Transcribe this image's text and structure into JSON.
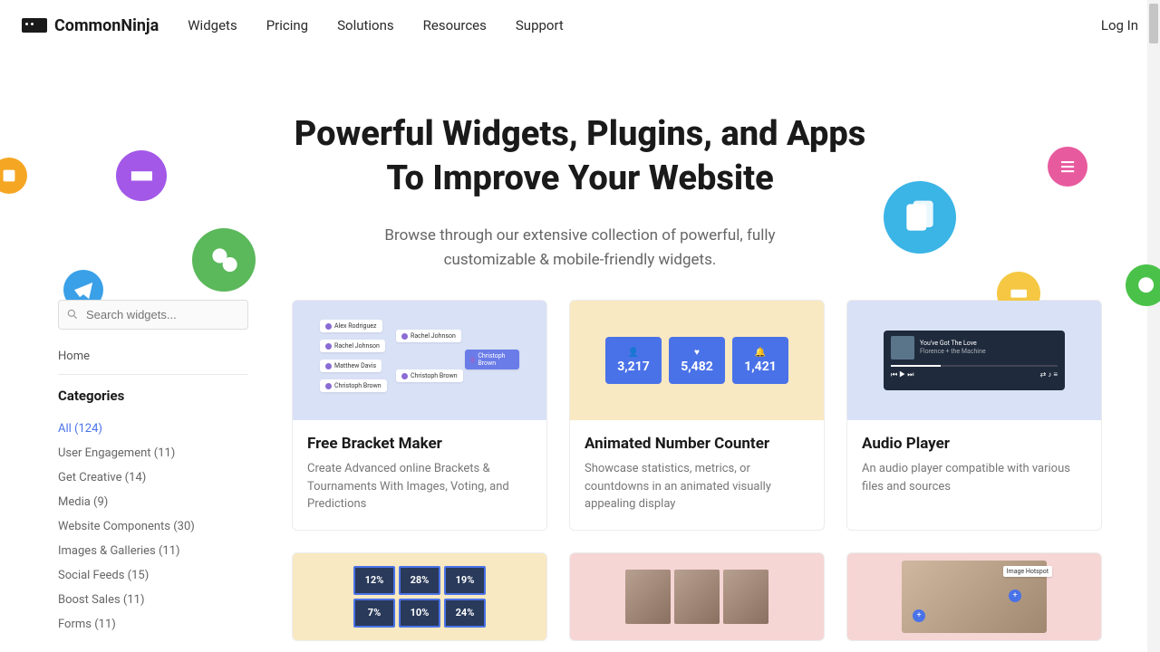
{
  "header": {
    "brand": "CommonNinja",
    "nav": [
      "Widgets",
      "Pricing",
      "Solutions",
      "Resources",
      "Support"
    ],
    "login": "Log In"
  },
  "hero": {
    "title_line1": "Powerful Widgets, Plugins, and Apps",
    "title_line2": "To Improve Your Website",
    "subtitle": "Browse through our extensive collection of powerful, fully customizable & mobile-friendly widgets."
  },
  "sidebar": {
    "search_placeholder": "Search widgets...",
    "home": "Home",
    "categories_title": "Categories",
    "categories": [
      {
        "label": "All (124)",
        "active": true
      },
      {
        "label": "User Engagement (11)"
      },
      {
        "label": "Get Creative (14)"
      },
      {
        "label": "Media (9)"
      },
      {
        "label": "Website Components (30)"
      },
      {
        "label": "Images & Galleries (11)"
      },
      {
        "label": "Social Feeds (15)"
      },
      {
        "label": "Boost Sales (11)"
      },
      {
        "label": "Forms (11)"
      }
    ]
  },
  "cards": [
    {
      "title": "Free Bracket Maker",
      "desc": "Create Advanced online Brackets & Tournaments With Images, Voting, and Predictions",
      "bg": "img-blue",
      "bracket_names": [
        "Alex Rodriguez",
        "Rachel Johnson",
        "Matthew Davis",
        "Christoph Brown",
        "Rachel Johnson",
        "Christoph Brown",
        "Christoph Brown"
      ],
      "winner_idx": 6
    },
    {
      "title": "Animated Number Counter",
      "desc": "Showcase statistics, metrics, or countdowns in an animated visually appealing display",
      "bg": "img-yellow",
      "counters": [
        {
          "icon": "👤",
          "value": "3,217"
        },
        {
          "icon": "♥",
          "value": "5,482"
        },
        {
          "icon": "🔔",
          "value": "1,421"
        }
      ]
    },
    {
      "title": "Audio Player",
      "desc": "An audio player compatible with various files and sources",
      "bg": "img-blue",
      "audio": {
        "track": "You've Got The Love",
        "artist": "Florence + the Machine"
      }
    },
    {
      "title": "",
      "desc": "",
      "bg": "img-yellow",
      "percentages": [
        "12%",
        "28%",
        "19%",
        "7%",
        "10%",
        "24%"
      ]
    },
    {
      "title": "",
      "desc": "",
      "bg": "img-pink"
    },
    {
      "title": "",
      "desc": "",
      "bg": "img-pink",
      "hotspot_label": "Image Hotspot"
    }
  ]
}
